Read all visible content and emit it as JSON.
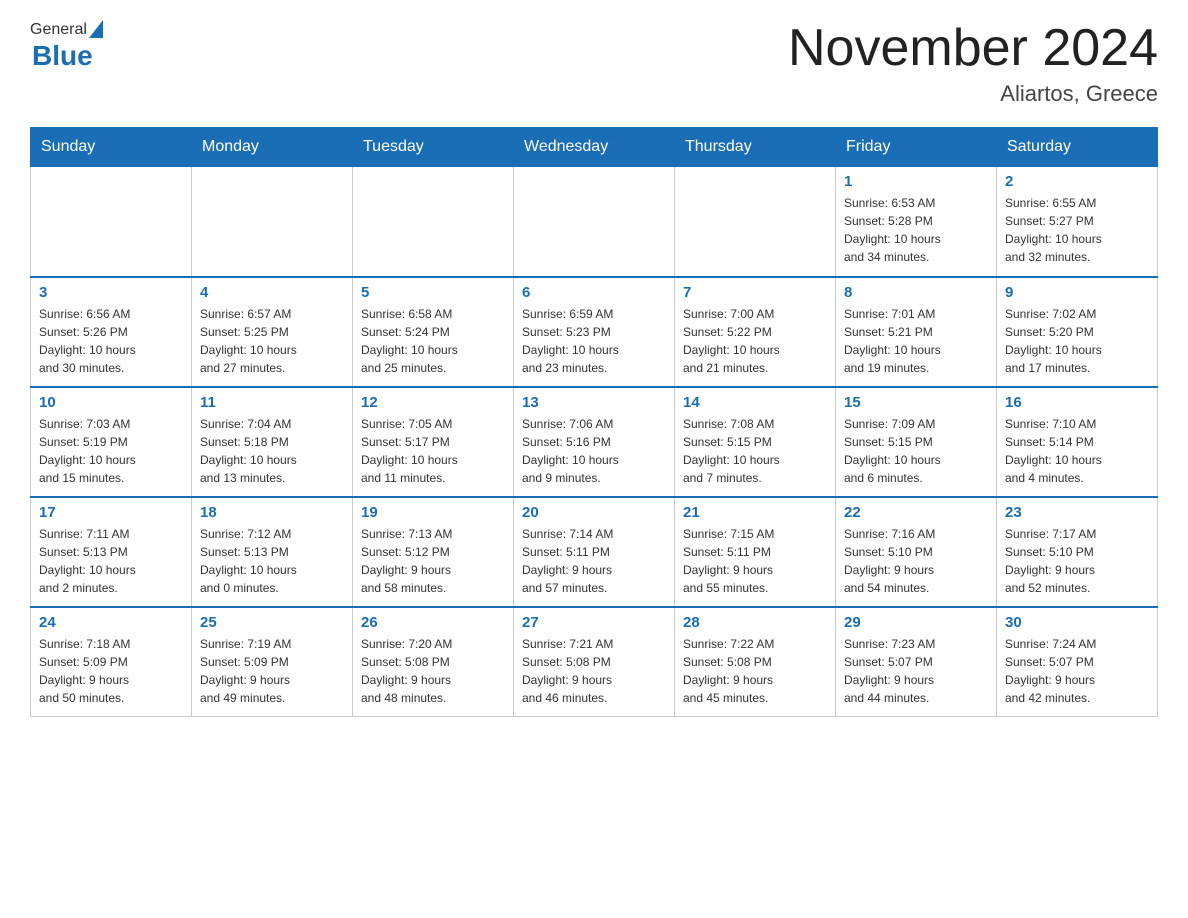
{
  "header": {
    "logo_general": "General",
    "logo_blue": "Blue",
    "month_title": "November 2024",
    "location": "Aliartos, Greece"
  },
  "days_of_week": [
    "Sunday",
    "Monday",
    "Tuesday",
    "Wednesday",
    "Thursday",
    "Friday",
    "Saturday"
  ],
  "weeks": [
    [
      {
        "day": "",
        "info": ""
      },
      {
        "day": "",
        "info": ""
      },
      {
        "day": "",
        "info": ""
      },
      {
        "day": "",
        "info": ""
      },
      {
        "day": "",
        "info": ""
      },
      {
        "day": "1",
        "info": "Sunrise: 6:53 AM\nSunset: 5:28 PM\nDaylight: 10 hours\nand 34 minutes."
      },
      {
        "day": "2",
        "info": "Sunrise: 6:55 AM\nSunset: 5:27 PM\nDaylight: 10 hours\nand 32 minutes."
      }
    ],
    [
      {
        "day": "3",
        "info": "Sunrise: 6:56 AM\nSunset: 5:26 PM\nDaylight: 10 hours\nand 30 minutes."
      },
      {
        "day": "4",
        "info": "Sunrise: 6:57 AM\nSunset: 5:25 PM\nDaylight: 10 hours\nand 27 minutes."
      },
      {
        "day": "5",
        "info": "Sunrise: 6:58 AM\nSunset: 5:24 PM\nDaylight: 10 hours\nand 25 minutes."
      },
      {
        "day": "6",
        "info": "Sunrise: 6:59 AM\nSunset: 5:23 PM\nDaylight: 10 hours\nand 23 minutes."
      },
      {
        "day": "7",
        "info": "Sunrise: 7:00 AM\nSunset: 5:22 PM\nDaylight: 10 hours\nand 21 minutes."
      },
      {
        "day": "8",
        "info": "Sunrise: 7:01 AM\nSunset: 5:21 PM\nDaylight: 10 hours\nand 19 minutes."
      },
      {
        "day": "9",
        "info": "Sunrise: 7:02 AM\nSunset: 5:20 PM\nDaylight: 10 hours\nand 17 minutes."
      }
    ],
    [
      {
        "day": "10",
        "info": "Sunrise: 7:03 AM\nSunset: 5:19 PM\nDaylight: 10 hours\nand 15 minutes."
      },
      {
        "day": "11",
        "info": "Sunrise: 7:04 AM\nSunset: 5:18 PM\nDaylight: 10 hours\nand 13 minutes."
      },
      {
        "day": "12",
        "info": "Sunrise: 7:05 AM\nSunset: 5:17 PM\nDaylight: 10 hours\nand 11 minutes."
      },
      {
        "day": "13",
        "info": "Sunrise: 7:06 AM\nSunset: 5:16 PM\nDaylight: 10 hours\nand 9 minutes."
      },
      {
        "day": "14",
        "info": "Sunrise: 7:08 AM\nSunset: 5:15 PM\nDaylight: 10 hours\nand 7 minutes."
      },
      {
        "day": "15",
        "info": "Sunrise: 7:09 AM\nSunset: 5:15 PM\nDaylight: 10 hours\nand 6 minutes."
      },
      {
        "day": "16",
        "info": "Sunrise: 7:10 AM\nSunset: 5:14 PM\nDaylight: 10 hours\nand 4 minutes."
      }
    ],
    [
      {
        "day": "17",
        "info": "Sunrise: 7:11 AM\nSunset: 5:13 PM\nDaylight: 10 hours\nand 2 minutes."
      },
      {
        "day": "18",
        "info": "Sunrise: 7:12 AM\nSunset: 5:13 PM\nDaylight: 10 hours\nand 0 minutes."
      },
      {
        "day": "19",
        "info": "Sunrise: 7:13 AM\nSunset: 5:12 PM\nDaylight: 9 hours\nand 58 minutes."
      },
      {
        "day": "20",
        "info": "Sunrise: 7:14 AM\nSunset: 5:11 PM\nDaylight: 9 hours\nand 57 minutes."
      },
      {
        "day": "21",
        "info": "Sunrise: 7:15 AM\nSunset: 5:11 PM\nDaylight: 9 hours\nand 55 minutes."
      },
      {
        "day": "22",
        "info": "Sunrise: 7:16 AM\nSunset: 5:10 PM\nDaylight: 9 hours\nand 54 minutes."
      },
      {
        "day": "23",
        "info": "Sunrise: 7:17 AM\nSunset: 5:10 PM\nDaylight: 9 hours\nand 52 minutes."
      }
    ],
    [
      {
        "day": "24",
        "info": "Sunrise: 7:18 AM\nSunset: 5:09 PM\nDaylight: 9 hours\nand 50 minutes."
      },
      {
        "day": "25",
        "info": "Sunrise: 7:19 AM\nSunset: 5:09 PM\nDaylight: 9 hours\nand 49 minutes."
      },
      {
        "day": "26",
        "info": "Sunrise: 7:20 AM\nSunset: 5:08 PM\nDaylight: 9 hours\nand 48 minutes."
      },
      {
        "day": "27",
        "info": "Sunrise: 7:21 AM\nSunset: 5:08 PM\nDaylight: 9 hours\nand 46 minutes."
      },
      {
        "day": "28",
        "info": "Sunrise: 7:22 AM\nSunset: 5:08 PM\nDaylight: 9 hours\nand 45 minutes."
      },
      {
        "day": "29",
        "info": "Sunrise: 7:23 AM\nSunset: 5:07 PM\nDaylight: 9 hours\nand 44 minutes."
      },
      {
        "day": "30",
        "info": "Sunrise: 7:24 AM\nSunset: 5:07 PM\nDaylight: 9 hours\nand 42 minutes."
      }
    ]
  ]
}
